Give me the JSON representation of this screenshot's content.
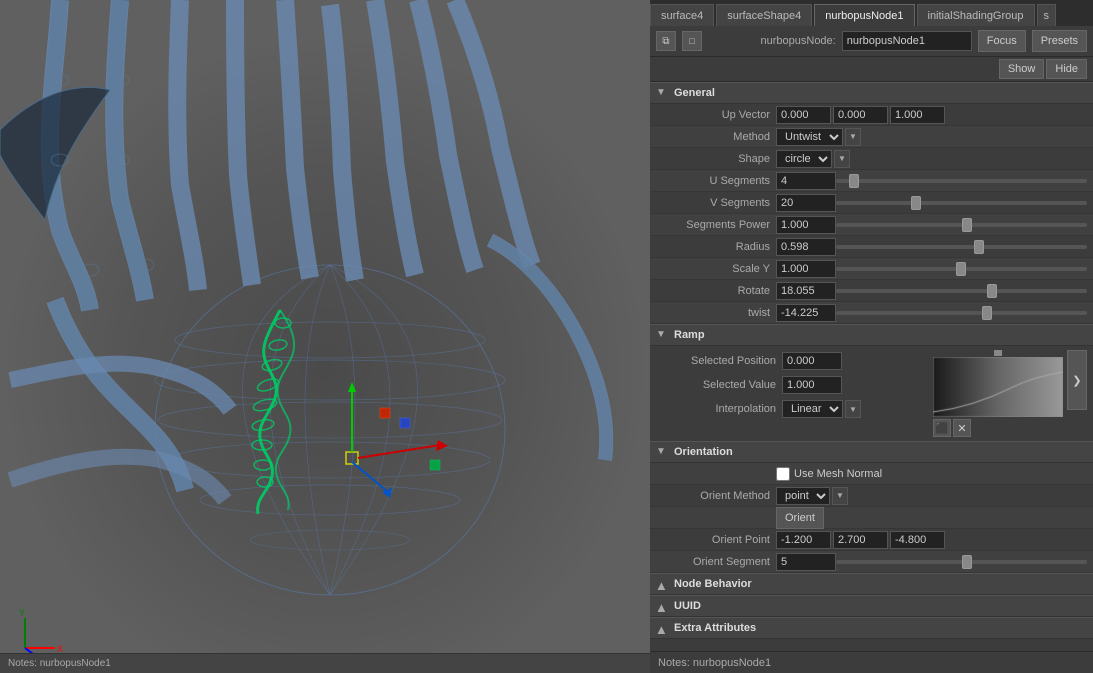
{
  "tabs": [
    {
      "id": "surface4",
      "label": "surface4",
      "active": false
    },
    {
      "id": "surfaceShape4",
      "label": "surfaceShape4",
      "active": false
    },
    {
      "id": "nurbopusNode1",
      "label": "nurbopusNode1",
      "active": true
    },
    {
      "id": "initialShadingGroup",
      "label": "initialShadingGroup",
      "active": false
    }
  ],
  "node": {
    "label": "nurbopusNode:",
    "value": "nurbopusNode1"
  },
  "buttons": {
    "focus": "Focus",
    "presets": "Presets",
    "show": "Show",
    "hide": "Hide"
  },
  "sections": {
    "general": {
      "title": "General",
      "expanded": true,
      "fields": {
        "up_vector": {
          "label": "Up Vector",
          "x": "0.000",
          "y": "0.000",
          "z": "1.000"
        },
        "method": {
          "label": "Method",
          "value": "Untwist"
        },
        "shape": {
          "label": "Shape",
          "value": "circle"
        },
        "u_segments": {
          "label": "U Segments",
          "value": "4",
          "slider_pct": 5
        },
        "v_segments": {
          "label": "V Segments",
          "value": "20",
          "slider_pct": 30
        },
        "segments_power": {
          "label": "Segments Power",
          "value": "1.000",
          "slider_pct": 50
        },
        "radius": {
          "label": "Radius",
          "value": "0.598",
          "slider_pct": 55
        },
        "scale_y": {
          "label": "Scale Y",
          "value": "1.000",
          "slider_pct": 48
        },
        "rotate": {
          "label": "Rotate",
          "value": "18.055",
          "slider_pct": 60
        },
        "twist": {
          "label": "twist",
          "value": "-14.225",
          "slider_pct": 58
        }
      }
    },
    "ramp": {
      "title": "Ramp",
      "expanded": true,
      "fields": {
        "selected_position": {
          "label": "Selected Position",
          "value": "0.000"
        },
        "selected_value": {
          "label": "Selected Value",
          "value": "1.000"
        },
        "interpolation": {
          "label": "Interpolation",
          "value": "Linear"
        }
      }
    },
    "orientation": {
      "title": "Orientation",
      "expanded": true,
      "fields": {
        "use_mesh_normal": {
          "label": "Use Mesh Normal"
        },
        "orient_method": {
          "label": "Orient Method",
          "value": "point"
        },
        "orient": {
          "label": "Orient"
        },
        "orient_point": {
          "label": "Orient Point",
          "x": "-1.200",
          "y": "2.700",
          "z": "-4.800"
        },
        "orient_segment": {
          "label": "Orient Segment",
          "value": "5",
          "slider_pct": 50
        }
      }
    },
    "node_behavior": {
      "title": "Node Behavior",
      "expanded": false
    },
    "uuid": {
      "title": "UUID",
      "expanded": false
    },
    "extra_attributes": {
      "title": "Extra Attributes",
      "expanded": false
    }
  },
  "notes": {
    "label": "Notes:",
    "value": "nurbopusNode1"
  },
  "icons": {
    "collapse_down": "▼",
    "collapse_right": "▶",
    "copy": "⧉",
    "arrow_right": "❯"
  }
}
